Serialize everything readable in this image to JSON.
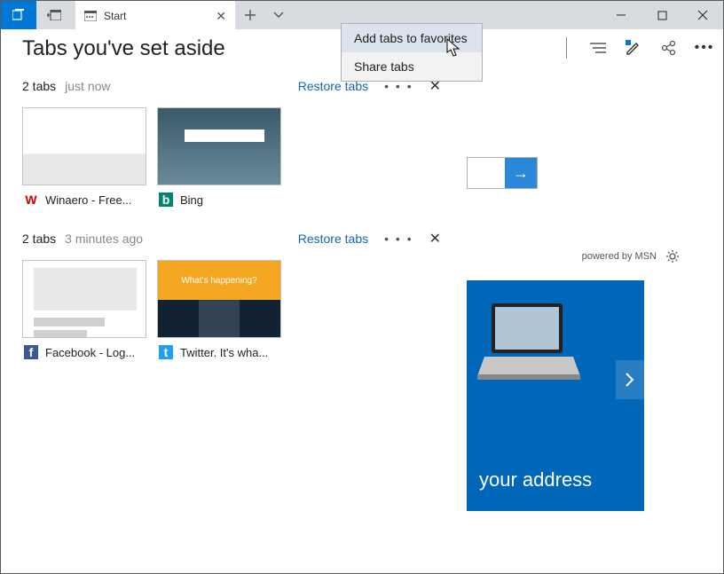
{
  "titlebar": {
    "tab_title": "Start"
  },
  "context_menu": {
    "item1": "Add tabs to favorites",
    "item2": "Share tabs"
  },
  "panel": {
    "title": "Tabs you've set aside"
  },
  "group1": {
    "count": "2 tabs",
    "time": "just now",
    "restore": "Restore tabs",
    "tiles": [
      {
        "title": "Winaero - Free...",
        "icon": "W"
      },
      {
        "title": "Bing",
        "icon": "b"
      }
    ]
  },
  "group2": {
    "count": "2 tabs",
    "time": "3 minutes ago",
    "restore": "Restore tabs",
    "tiles": [
      {
        "title": "Facebook - Log...",
        "icon": "f"
      },
      {
        "title": "Twitter. It's wha...",
        "icon": "t"
      }
    ]
  },
  "twitter_thumb": "What's happening?",
  "rside": {
    "powered": "powered by MSN",
    "banner_text": "your address"
  }
}
